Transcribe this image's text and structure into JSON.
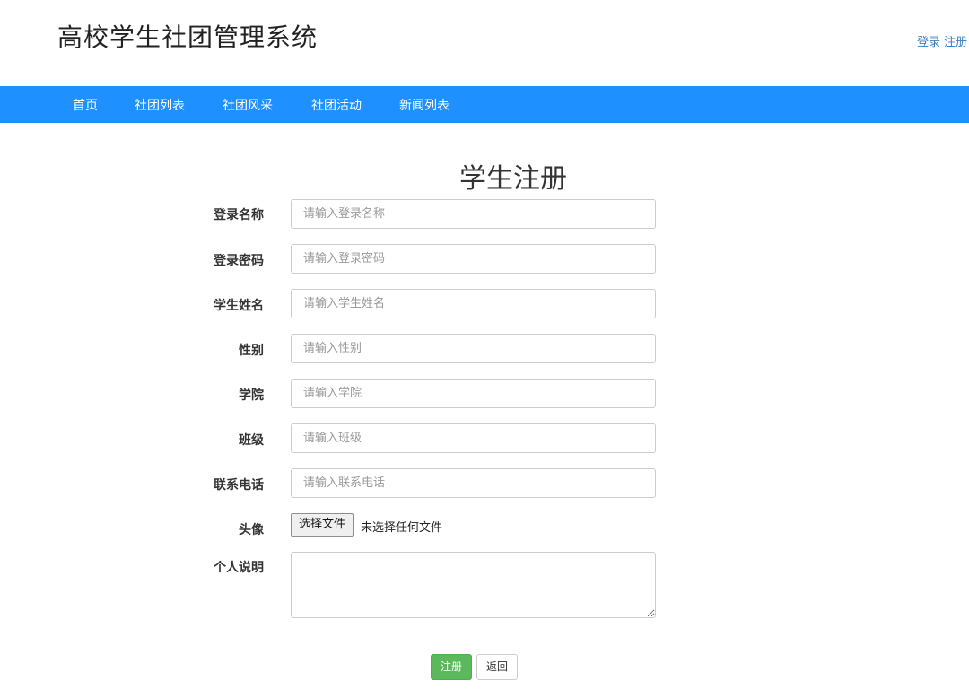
{
  "header": {
    "site_title": "高校学生社团管理系统",
    "login_link": "登录",
    "register_link": "注册"
  },
  "nav": {
    "items": [
      "首页",
      "社团列表",
      "社团风采",
      "社团活动",
      "新闻列表"
    ]
  },
  "form": {
    "title": "学生注册",
    "fields": [
      {
        "label": "登录名称",
        "placeholder": "请输入登录名称",
        "value": ""
      },
      {
        "label": "登录密码",
        "placeholder": "请输入登录密码",
        "value": ""
      },
      {
        "label": "学生姓名",
        "placeholder": "请输入学生姓名",
        "value": ""
      },
      {
        "label": "性别",
        "placeholder": "请输入性别",
        "value": ""
      },
      {
        "label": "学院",
        "placeholder": "请输入学院",
        "value": ""
      },
      {
        "label": "班级",
        "placeholder": "请输入班级",
        "value": ""
      },
      {
        "label": "联系电话",
        "placeholder": "请输入联系电话",
        "value": ""
      }
    ],
    "avatar": {
      "label": "头像",
      "button": "选择文件",
      "status": "未选择任何文件"
    },
    "description": {
      "label": "个人说明",
      "value": ""
    },
    "submit_label": "注册",
    "back_label": "返回"
  },
  "colors": {
    "nav_background": "#1e90ff",
    "link": "#3a7fc0",
    "submit_button": "#5cb85c"
  }
}
